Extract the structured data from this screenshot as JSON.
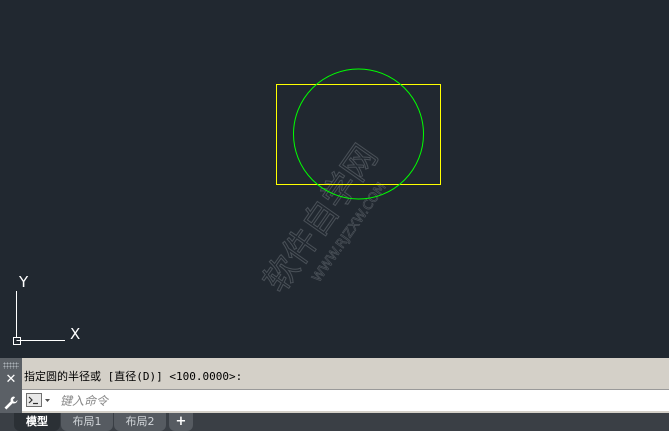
{
  "canvas": {
    "background": "#212830",
    "ucs_icon": {
      "y_label": "Y",
      "x_label": "X"
    },
    "watermark_text": "软件自学网",
    "watermark_sub": "WWW.RJZXW.COM",
    "rect_color": "#ffff00",
    "circle_color": "#00ff00"
  },
  "command_line": {
    "history": "指定圆的半径或 [直径(D)] <100.0000>:",
    "input_placeholder": "键入命令",
    "close_icon": "close-icon",
    "settings_icon": "wrench-icon",
    "prompt_icon": "command-prompt-icon"
  },
  "tabs": [
    {
      "label": "模型",
      "active": true
    },
    {
      "label": "布局1",
      "active": false
    },
    {
      "label": "布局2",
      "active": false
    },
    {
      "label": "+",
      "active": false
    }
  ]
}
